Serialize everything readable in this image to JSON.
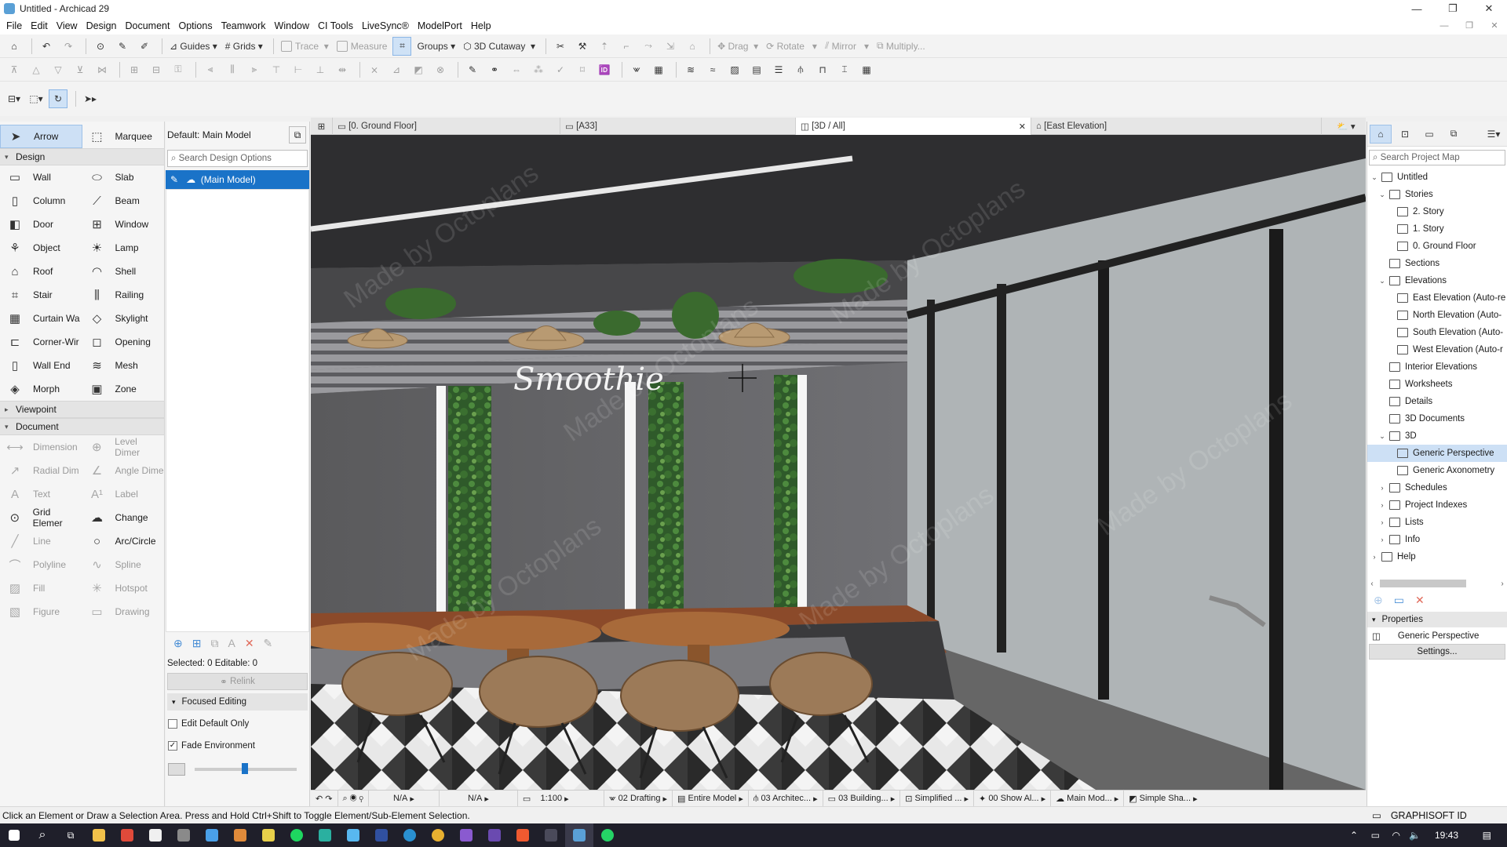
{
  "window": {
    "title": "Untitled - Archicad 29",
    "controls": [
      "—",
      "❐",
      "✕"
    ]
  },
  "menu": [
    "File",
    "Edit",
    "View",
    "Design",
    "Document",
    "Options",
    "Teamwork",
    "Window",
    "CI Tools",
    "LiveSync®",
    "ModelPort",
    "Help"
  ],
  "toolbar1": {
    "guides": "Guides",
    "grids": "Grids",
    "trace": "Trace",
    "measure": "Measure",
    "groups": "Groups",
    "cutaway": "3D Cutaway",
    "drag": "Drag",
    "rotate": "Rotate",
    "mirror": "Mirror",
    "multiply": "Multiply..."
  },
  "toolbox": {
    "arrow": "Arrow",
    "marquee": "Marquee",
    "design_header": "Design",
    "design_tools": [
      [
        "Wall",
        "Slab"
      ],
      [
        "Column",
        "Beam"
      ],
      [
        "Door",
        "Window"
      ],
      [
        "Object",
        "Lamp"
      ],
      [
        "Roof",
        "Shell"
      ],
      [
        "Stair",
        "Railing"
      ],
      [
        "Curtain Wa",
        "Skylight"
      ],
      [
        "Corner-Wir",
        "Opening"
      ],
      [
        "Wall End",
        "Mesh"
      ],
      [
        "Morph",
        "Zone"
      ]
    ],
    "viewpoint_header": "Viewpoint",
    "document_header": "Document",
    "document_tools": [
      [
        "Dimension",
        "Level Dimer"
      ],
      [
        "Radial Dim",
        "Angle Dime"
      ],
      [
        "Text",
        "Label"
      ],
      [
        "Grid Elemer",
        "Change"
      ],
      [
        "Line",
        "Arc/Circle"
      ],
      [
        "Polyline",
        "Spline"
      ],
      [
        "Fill",
        "Hotspot"
      ],
      [
        "Figure",
        "Drawing"
      ]
    ]
  },
  "design_options": {
    "header": "Default: Main Model",
    "search_placeholder": "Search Design Options",
    "main_model": "(Main Model)",
    "selected": "Selected: 0 Editable: 0",
    "relink": "Relink",
    "focused_editing": "Focused Editing",
    "edit_default_only": "Edit Default Only",
    "fade_environment": "Fade Environment",
    "edit_default_checked": false,
    "fade_checked": true
  },
  "tabs": [
    {
      "label": "[0. Ground Floor]",
      "active": false
    },
    {
      "label": "[A33]",
      "active": false
    },
    {
      "label": "[3D / All]",
      "active": true
    },
    {
      "label": "[East Elevation]",
      "active": false
    }
  ],
  "scene": {
    "sign_text": "Smoothie",
    "watermark": "Made by Octoplans"
  },
  "view_status": [
    "N/A",
    "N/A",
    "1:100",
    "02 Drafting",
    "Entire Model",
    "03 Architec...",
    "03 Building...",
    "Simplified ...",
    "00 Show Al...",
    "Main Mod...",
    "Simple Sha..."
  ],
  "navigator": {
    "search_placeholder": "Search Project Map",
    "tree": [
      {
        "label": "Untitled",
        "level": 0,
        "arrow": "⌄"
      },
      {
        "label": "Stories",
        "level": 1,
        "arrow": "⌄"
      },
      {
        "label": "2. Story",
        "level": 2,
        "arrow": ""
      },
      {
        "label": "1. Story",
        "level": 2,
        "arrow": ""
      },
      {
        "label": "0. Ground Floor",
        "level": 2,
        "arrow": ""
      },
      {
        "label": "Sections",
        "level": 1,
        "arrow": ""
      },
      {
        "label": "Elevations",
        "level": 1,
        "arrow": "⌄"
      },
      {
        "label": "East Elevation (Auto-re",
        "level": 2,
        "arrow": ""
      },
      {
        "label": "North Elevation (Auto-",
        "level": 2,
        "arrow": ""
      },
      {
        "label": "South Elevation (Auto-",
        "level": 2,
        "arrow": ""
      },
      {
        "label": "West Elevation (Auto-r",
        "level": 2,
        "arrow": ""
      },
      {
        "label": "Interior Elevations",
        "level": 1,
        "arrow": ""
      },
      {
        "label": "Worksheets",
        "level": 1,
        "arrow": ""
      },
      {
        "label": "Details",
        "level": 1,
        "arrow": ""
      },
      {
        "label": "3D Documents",
        "level": 1,
        "arrow": ""
      },
      {
        "label": "3D",
        "level": 1,
        "arrow": "⌄"
      },
      {
        "label": "Generic Perspective",
        "level": 2,
        "arrow": "",
        "selected": true
      },
      {
        "label": "Generic Axonometry",
        "level": 2,
        "arrow": ""
      },
      {
        "label": "Schedules",
        "level": 1,
        "arrow": "›"
      },
      {
        "label": "Project Indexes",
        "level": 1,
        "arrow": "›"
      },
      {
        "label": "Lists",
        "level": 1,
        "arrow": "›"
      },
      {
        "label": "Info",
        "level": 1,
        "arrow": "›"
      },
      {
        "label": "Help",
        "level": 0,
        "arrow": "›"
      }
    ],
    "properties": "Properties",
    "prop_value": "Generic Perspective",
    "settings": "Settings..."
  },
  "status_message": "Click an Element or Draw a Selection Area. Press and Hold Ctrl+Shift to Toggle Element/Sub-Element Selection.",
  "graphisoft_id": "GRAPHISOFT ID",
  "clock": "19:43",
  "colors": {
    "accent": "#1a73c8",
    "selection": "#cde0f5",
    "taskbar": "#1f1f2a"
  }
}
